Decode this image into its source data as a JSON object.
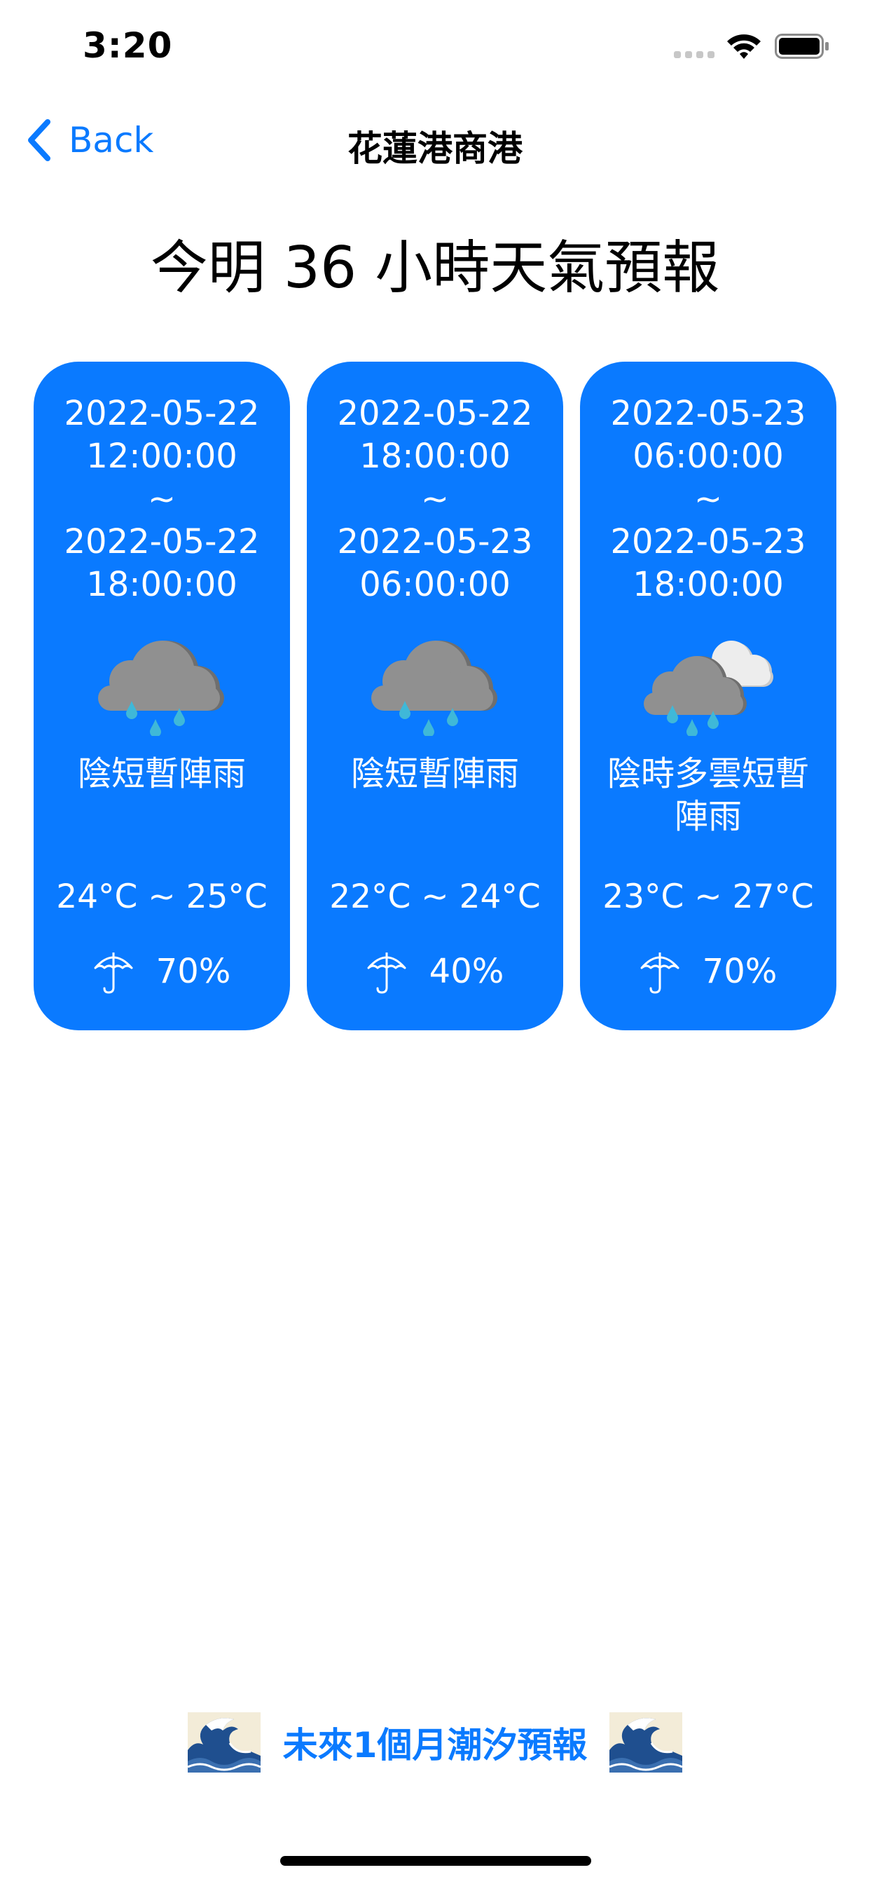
{
  "status_bar": {
    "time": "3:20"
  },
  "nav": {
    "back_label": "Back",
    "title": "花蓮港商港"
  },
  "heading": "今明 36 小時天氣預報",
  "forecasts": [
    {
      "start_date": "2022-05-22",
      "start_time": "12:00:00",
      "separator": "~",
      "end_date": "2022-05-22",
      "end_time": "18:00:00",
      "icon": "rain-cloud-icon",
      "description": "陰短暫陣雨",
      "temperature": "24°C ~ 25°C",
      "rain_probability": "70%"
    },
    {
      "start_date": "2022-05-22",
      "start_time": "18:00:00",
      "separator": "~",
      "end_date": "2022-05-23",
      "end_time": "06:00:00",
      "icon": "rain-cloud-icon",
      "description": "陰短暫陣雨",
      "temperature": "22°C ~ 24°C",
      "rain_probability": "40%"
    },
    {
      "start_date": "2022-05-23",
      "start_time": "06:00:00",
      "separator": "~",
      "end_date": "2022-05-23",
      "end_time": "18:00:00",
      "icon": "cloudy-rain-icon",
      "description": "陰時多雲短暫陣雨",
      "temperature": "23°C ~ 27°C",
      "rain_probability": "70%"
    }
  ],
  "tide_link": {
    "label": "未來1個月潮汐預報",
    "icon": "wave-icon"
  },
  "colors": {
    "accent": "#0a7aff",
    "card_background": "#0a7aff",
    "card_text": "#ffffff",
    "dark_cloud": "#8e8e8e",
    "light_cloud": "#e4e4e4",
    "raindrop": "#3fb8d8"
  }
}
